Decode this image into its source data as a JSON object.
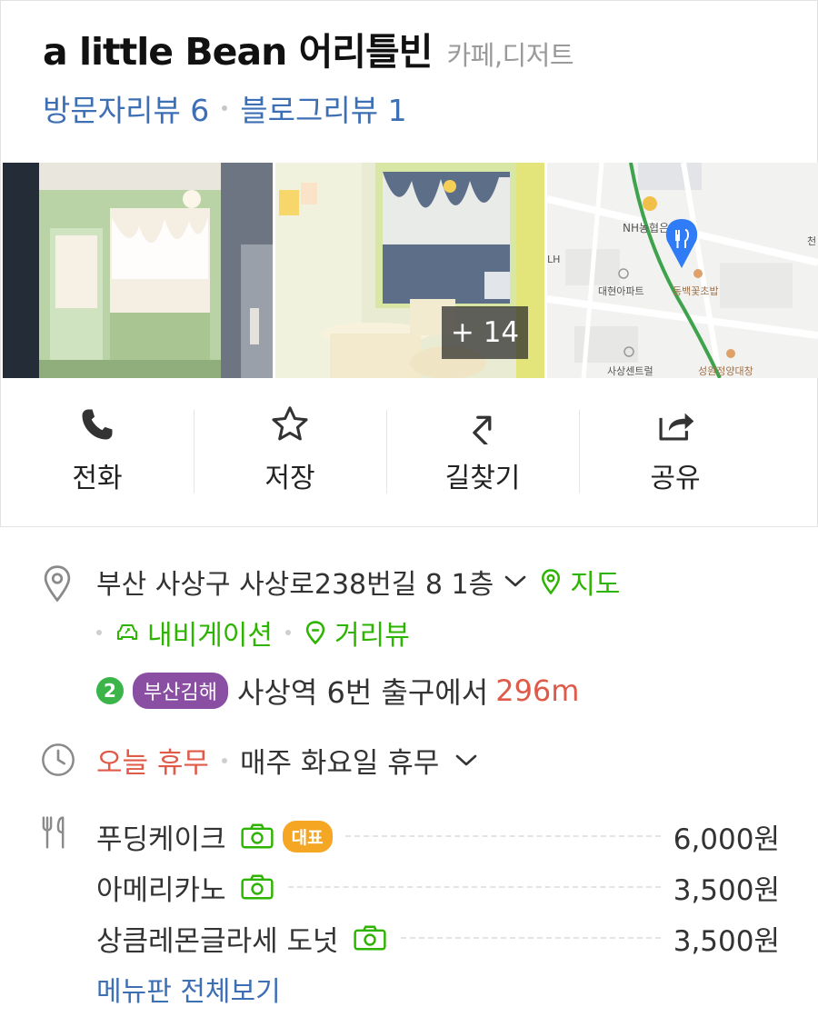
{
  "header": {
    "title": "a little Bean 어리틀빈",
    "category": "카페,디저트",
    "visitor_reviews": "방문자리뷰 6",
    "blog_reviews": "블로그리뷰 1"
  },
  "photos": {
    "more_count": "+ 14"
  },
  "map_thumb": {
    "labels": [
      "NH농협은",
      "LH",
      "대현아파트",
      "동백꽃초밥",
      "사상센트럴",
      "성원정양대창",
      "천"
    ]
  },
  "actions": [
    {
      "label": "전화",
      "icon": "phone-icon"
    },
    {
      "label": "저장",
      "icon": "star-icon"
    },
    {
      "label": "길찾기",
      "icon": "directions-icon"
    },
    {
      "label": "공유",
      "icon": "share-icon"
    }
  ],
  "info": {
    "address": "부산 사상구 사상로238번길 8 1층",
    "map_link": "지도",
    "navigation_link": "내비게이션",
    "street_view_link": "거리뷰",
    "subway": {
      "line_number": "2",
      "line_name": "부산김해",
      "station_text": "사상역 6번 출구에서",
      "distance": "296m"
    },
    "hours": {
      "status": "오늘 휴무",
      "description": "매주 화요일 휴무"
    },
    "menu": [
      {
        "name": "푸딩케이크",
        "badge": "대표",
        "price": "6,000원"
      },
      {
        "name": "아메리카노",
        "badge": "",
        "price": "3,500원"
      },
      {
        "name": "상큼레몬글라세 도넛",
        "badge": "",
        "price": "3,500원"
      }
    ],
    "menu_all": "메뉴판 전체보기"
  },
  "colors": {
    "link_blue": "#3d6fb5",
    "green": "#2db400",
    "red": "#e05a4a",
    "subway_line2": "#3bb44a",
    "busan_gimhae": "#8a4fa3",
    "badge_orange": "#f5a623"
  }
}
